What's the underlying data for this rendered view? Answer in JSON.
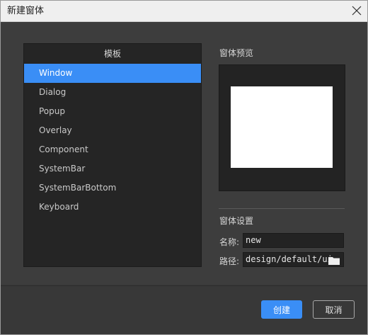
{
  "window": {
    "title": "新建窗体"
  },
  "templates": {
    "header": "模板",
    "items": [
      {
        "label": "Window",
        "selected": true
      },
      {
        "label": "Dialog",
        "selected": false
      },
      {
        "label": "Popup",
        "selected": false
      },
      {
        "label": "Overlay",
        "selected": false
      },
      {
        "label": "Component",
        "selected": false
      },
      {
        "label": "SystemBar",
        "selected": false
      },
      {
        "label": "SystemBarBottom",
        "selected": false
      },
      {
        "label": "Keyboard",
        "selected": false
      }
    ]
  },
  "preview": {
    "label": "窗体预览"
  },
  "settings": {
    "label": "窗体设置",
    "name_label": "名称:",
    "name_value": "new",
    "path_label": "路径:",
    "path_value": "design/default/ui"
  },
  "buttons": {
    "create": "创建",
    "cancel": "取消"
  },
  "icons": {
    "close": "close-icon",
    "folder": "folder-icon"
  },
  "colors": {
    "accent": "#3a8ef6",
    "background": "#3d3d3d",
    "panel": "#252525"
  }
}
